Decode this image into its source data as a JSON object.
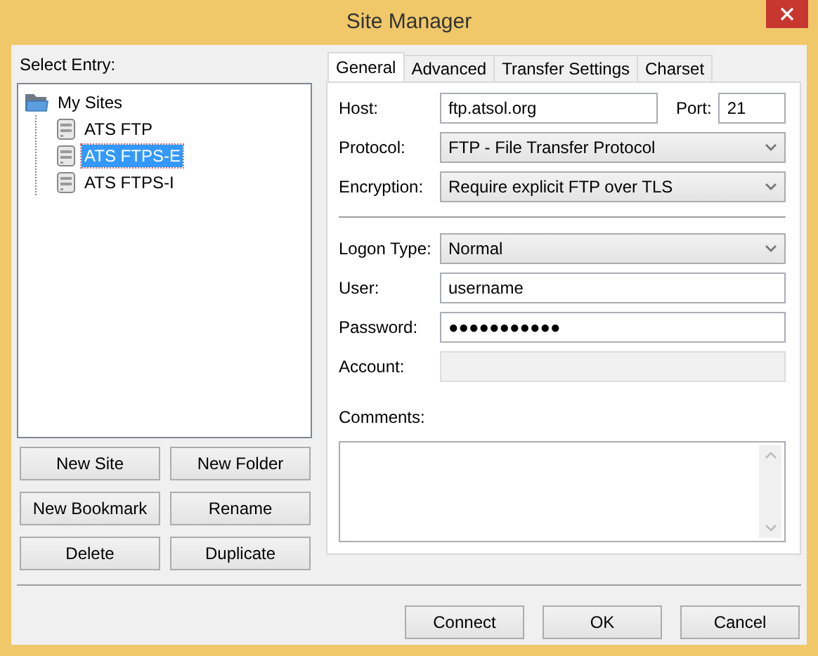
{
  "window": {
    "title": "Site Manager"
  },
  "entry_label": "Select Entry:",
  "tree": [
    {
      "label": "My Sites",
      "kind": "folder",
      "expanded": true,
      "selected": false,
      "children": [
        {
          "label": "ATS FTP",
          "kind": "site",
          "selected": false
        },
        {
          "label": "ATS FTPS-E",
          "kind": "site",
          "selected": true
        },
        {
          "label": "ATS FTPS-I",
          "kind": "site",
          "selected": false
        }
      ]
    }
  ],
  "entry_buttons": [
    "New Site",
    "New Folder",
    "New Bookmark",
    "Rename",
    "Delete",
    "Duplicate"
  ],
  "tabs": [
    {
      "label": "General",
      "selected": true
    },
    {
      "label": "Advanced",
      "selected": false
    },
    {
      "label": "Transfer Settings",
      "selected": false
    },
    {
      "label": "Charset",
      "selected": false
    }
  ],
  "host": {
    "label": "Host:",
    "value": "ftp.atsol.org"
  },
  "port": {
    "label": "Port:",
    "value": "21"
  },
  "connection_fields": [
    {
      "label": "Protocol:",
      "kind": "select",
      "value": "FTP - File Transfer Protocol",
      "disabled": false
    },
    {
      "label": "Encryption:",
      "kind": "select",
      "value": "Require explicit FTP over TLS",
      "disabled": false
    }
  ],
  "login_fields": [
    {
      "label": "Logon Type:",
      "kind": "select",
      "value": "Normal",
      "disabled": false
    },
    {
      "label": "User:",
      "kind": "text",
      "value": "username",
      "disabled": false
    },
    {
      "label": "Password:",
      "kind": "text",
      "value": "●●●●●●●●●●●",
      "disabled": false
    },
    {
      "label": "Account:",
      "kind": "text",
      "disabled": true
    }
  ],
  "comments": {
    "label": "Comments:"
  },
  "dialog_buttons": [
    "Connect",
    "OK",
    "Cancel"
  ]
}
